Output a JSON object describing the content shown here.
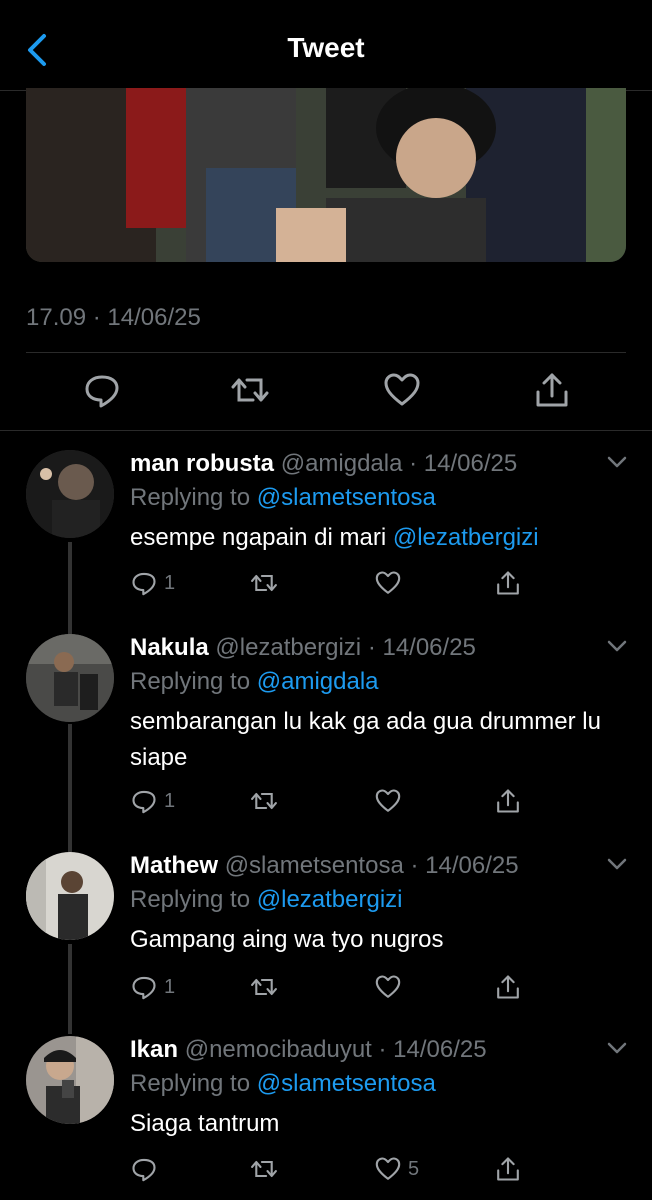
{
  "header": {
    "title": "Tweet"
  },
  "tweet": {
    "timestamp": "17.09 · 14/06/25"
  },
  "replies": [
    {
      "name": "man robusta",
      "handle": "@amigdala",
      "date": "· 14/06/25",
      "replying_prefix": "Replying to ",
      "replying_to": "@slametsentosa",
      "text": "esempe ngapain di mari ",
      "mention": "@lezatbergizi",
      "reply_count": "1",
      "like_count": ""
    },
    {
      "name": "Nakula",
      "handle": "@lezatbergizi",
      "date": "· 14/06/25",
      "replying_prefix": "Replying to ",
      "replying_to": "@amigdala",
      "text": "sembarangan lu kak ga ada gua drummer lu siape",
      "mention": "",
      "reply_count": "1",
      "like_count": ""
    },
    {
      "name": "Mathew",
      "handle": "@slametsentosa",
      "date": "· 14/06/25",
      "replying_prefix": "Replying to ",
      "replying_to": "@lezatbergizi",
      "text": "Gampang aing wa tyo nugros",
      "mention": "",
      "reply_count": "1",
      "like_count": ""
    },
    {
      "name": "Ikan",
      "handle": "@nemocibaduyut",
      "date": "· 14/06/25",
      "replying_prefix": "Replying to ",
      "replying_to": "@slametsentosa",
      "text": "Siaga tantrum",
      "mention": "",
      "reply_count": "",
      "like_count": "5"
    }
  ],
  "colors": {
    "accent": "#1d9bf0",
    "muted": "#71767b",
    "background": "#000000"
  }
}
